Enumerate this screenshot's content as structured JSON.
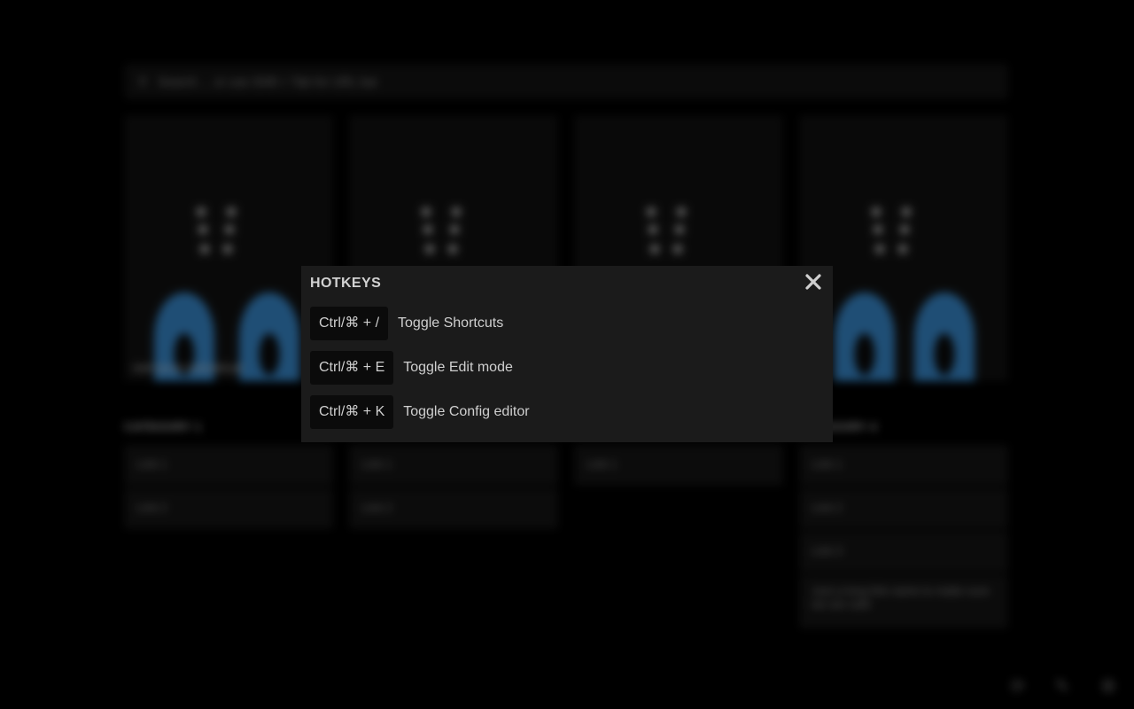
{
  "search": {
    "label": "Search",
    "hint": "... or use Shift + Tab for URL bar"
  },
  "cards": [
    {
      "caption": "meh-ipsum-kokodoll.pb"
    },
    {
      "caption": ""
    },
    {
      "caption": ""
    },
    {
      "caption": "..."
    }
  ],
  "categories": [
    {
      "title": "CATEGORY 1",
      "links": [
        "Link 1",
        "Link 2"
      ]
    },
    {
      "title": "",
      "links": [
        "Link 1",
        "Link 2"
      ]
    },
    {
      "title": "",
      "links": [
        "Link 1"
      ]
    },
    {
      "title": "CATEGORY 4",
      "links": [
        "Link 1",
        "Link 2",
        "Link 3",
        "Just a long link name to make sure we are safe"
      ]
    }
  ],
  "hotkeys_modal": {
    "title": "HOTKEYS",
    "close_icon": "close-icon",
    "items": [
      {
        "keys": "Ctrl/⌘ + /",
        "description": "Toggle Shortcuts"
      },
      {
        "keys": "Ctrl/⌘ + E",
        "description": "Toggle Edit mode"
      },
      {
        "keys": "Ctrl/⌘ + K",
        "description": "Toggle Config editor"
      }
    ]
  },
  "corner_icons": [
    "sync-icon",
    "pencil-icon",
    "gear-icon"
  ],
  "colors": {
    "modal_bg": "#1b1b1b",
    "kbd_bg": "#0b0b0b",
    "accent_ring": "#3a8fd6",
    "text": "#cfcfcf"
  }
}
